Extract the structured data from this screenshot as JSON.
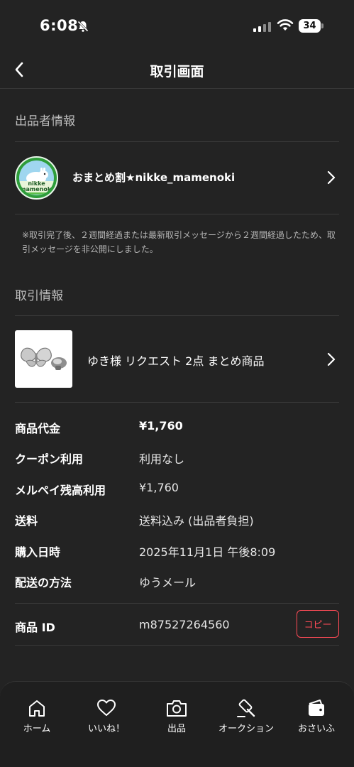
{
  "status_bar": {
    "time": "6:08",
    "battery": "34"
  },
  "header": {
    "title": "取引画面"
  },
  "seller_section": {
    "title": "出品者情報",
    "seller_name": "おまとめ割★nikke_mamenoki",
    "avatar_text": "nikke mamenoki"
  },
  "notice": "※取引完了後、２週間経過または最新取引メッセージから２週間経過したため、取引メッセージを非公開にしました。",
  "transaction_section": {
    "title": "取引情報",
    "product_title": "ゆき様 リクエスト 2点 まとめ商品"
  },
  "details": [
    {
      "label": "商品代金",
      "value": "¥1,760"
    },
    {
      "label": "クーポン利用",
      "value": "利用なし"
    },
    {
      "label": "メルペイ残高利用",
      "value": "¥1,760"
    },
    {
      "label": "送料",
      "value": "送料込み (出品者負担)"
    },
    {
      "label": "購入日時",
      "value": "2025年11月1日 午後8:09"
    },
    {
      "label": "配送の方法",
      "value": "ゆうメール"
    }
  ],
  "product_id": {
    "label": "商品 ID",
    "value": "m87527264560",
    "copy_label": "コピー"
  },
  "bottom_nav": [
    {
      "label": "ホーム",
      "icon": "home-icon"
    },
    {
      "label": "いいね！",
      "icon": "heart-icon"
    },
    {
      "label": "出品",
      "icon": "camera-icon"
    },
    {
      "label": "オークション",
      "icon": "gavel-icon"
    },
    {
      "label": "おさいふ",
      "icon": "wallet-icon"
    }
  ],
  "colors": {
    "background": "#232323",
    "accent": "#ff4b57",
    "divider": "#3a3a3a"
  }
}
